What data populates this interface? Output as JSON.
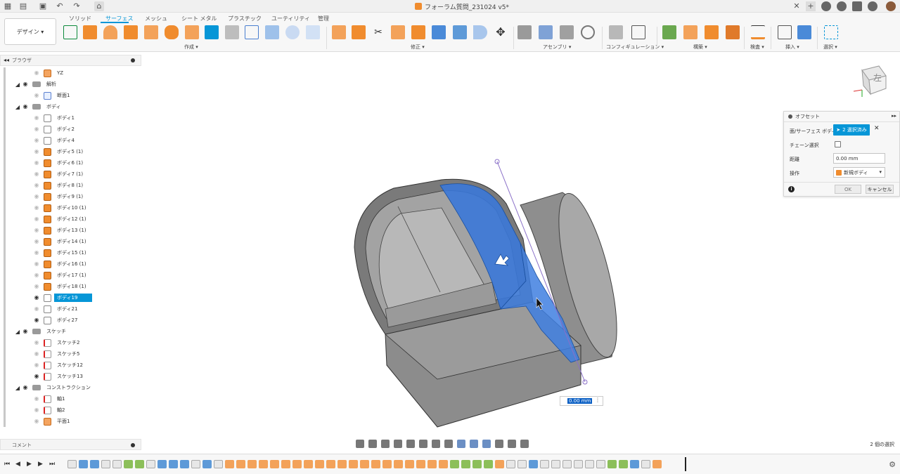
{
  "window": {
    "title": "フォーラム質問_231024 v5*"
  },
  "ribbon": {
    "workspace_label": "デザイン ▾",
    "tabs": [
      "ソリッド",
      "サーフェス",
      "メッシュ",
      "シート メタル",
      "プラスチック",
      "ユーティリティ",
      "管理"
    ],
    "active_tab": "サーフェス",
    "groups": [
      "作成 ▾",
      "修正 ▾",
      "アセンブリ ▾",
      "コンフィギュレーション ▾",
      "構築 ▾",
      "検査 ▾",
      "挿入 ▾",
      "選択 ▾"
    ]
  },
  "browser": {
    "title": "ブラウザ",
    "items": [
      {
        "label": "YZ",
        "icon": "plane-icon",
        "visible": false,
        "selected": false,
        "expand": false
      },
      {
        "label": "解析",
        "icon": "folder-icon",
        "visible": true,
        "selected": false,
        "expand": true
      },
      {
        "label": "断面1",
        "icon": "analysis-icon",
        "visible": false,
        "selected": false,
        "expand": false
      },
      {
        "label": "ボディ",
        "icon": "folder-icon",
        "visible": true,
        "selected": false,
        "expand": true
      },
      {
        "label": "ボディ1",
        "icon": "body-icon",
        "visible": false,
        "selected": false,
        "expand": false
      },
      {
        "label": "ボディ2",
        "icon": "body-icon",
        "visible": false,
        "selected": false,
        "expand": false
      },
      {
        "label": "ボディ4",
        "icon": "body-icon",
        "visible": false,
        "selected": false,
        "expand": false
      },
      {
        "label": "ボディ5 (1)",
        "icon": "component-icon",
        "visible": false,
        "selected": false,
        "expand": false
      },
      {
        "label": "ボディ6 (1)",
        "icon": "component-icon",
        "visible": false,
        "selected": false,
        "expand": false
      },
      {
        "label": "ボディ7 (1)",
        "icon": "component-icon",
        "visible": false,
        "selected": false,
        "expand": false
      },
      {
        "label": "ボディ8 (1)",
        "icon": "component-icon",
        "visible": false,
        "selected": false,
        "expand": false
      },
      {
        "label": "ボディ9 (1)",
        "icon": "component-icon",
        "visible": false,
        "selected": false,
        "expand": false
      },
      {
        "label": "ボディ10 (1)",
        "icon": "component-icon",
        "visible": false,
        "selected": false,
        "expand": false
      },
      {
        "label": "ボディ12 (1)",
        "icon": "component-icon",
        "visible": false,
        "selected": false,
        "expand": false
      },
      {
        "label": "ボディ13 (1)",
        "icon": "component-icon",
        "visible": false,
        "selected": false,
        "expand": false
      },
      {
        "label": "ボディ14 (1)",
        "icon": "component-icon",
        "visible": false,
        "selected": false,
        "expand": false
      },
      {
        "label": "ボディ15 (1)",
        "icon": "component-icon",
        "visible": false,
        "selected": false,
        "expand": false
      },
      {
        "label": "ボディ16 (1)",
        "icon": "component-icon",
        "visible": false,
        "selected": false,
        "expand": false
      },
      {
        "label": "ボディ17 (1)",
        "icon": "component-icon",
        "visible": false,
        "selected": false,
        "expand": false
      },
      {
        "label": "ボディ18 (1)",
        "icon": "component-icon",
        "visible": false,
        "selected": false,
        "expand": false
      },
      {
        "label": "ボディ19",
        "icon": "body-icon",
        "visible": true,
        "selected": true,
        "expand": false
      },
      {
        "label": "ボディ21",
        "icon": "body-icon",
        "visible": false,
        "selected": false,
        "expand": false
      },
      {
        "label": "ボディ27",
        "icon": "body-icon",
        "visible": true,
        "selected": false,
        "expand": false
      },
      {
        "label": "スケッチ",
        "icon": "folder-icon",
        "visible": true,
        "selected": false,
        "expand": true
      },
      {
        "label": "スケッチ2",
        "icon": "sketch-icon",
        "visible": false,
        "selected": false,
        "expand": false
      },
      {
        "label": "スケッチ5",
        "icon": "sketch-icon",
        "visible": false,
        "selected": false,
        "expand": false
      },
      {
        "label": "スケッチ12",
        "icon": "sketch-icon",
        "visible": false,
        "selected": false,
        "expand": false
      },
      {
        "label": "スケッチ13",
        "icon": "sketch-icon",
        "visible": true,
        "selected": false,
        "expand": false
      },
      {
        "label": "コンストラクション",
        "icon": "folder-icon",
        "visible": true,
        "selected": false,
        "expand": true
      },
      {
        "label": "軸1",
        "icon": "axis-icon",
        "visible": false,
        "selected": false,
        "expand": false
      },
      {
        "label": "軸2",
        "icon": "axis-icon",
        "visible": false,
        "selected": false,
        "expand": false
      },
      {
        "label": "平面1",
        "icon": "plane-icon",
        "visible": false,
        "selected": false,
        "expand": false
      }
    ]
  },
  "comments": {
    "title": "コメント"
  },
  "viewcube": {
    "face_label": "左"
  },
  "offset_panel": {
    "title": "オフセット",
    "surface_label": "面/サーフェス ボディ",
    "selection_button": "2 選択済み",
    "chain_label": "チェーン選択",
    "distance_label": "距離",
    "distance_value": "0.00 mm",
    "operation_label": "操作",
    "operation_value": "新規ボディ",
    "ok": "OK",
    "cancel": "キャンセル"
  },
  "manipulator": {
    "value": "0.00 mm"
  },
  "status": {
    "selection_count": "2 個の選択"
  },
  "colors": {
    "accent": "#0696d7",
    "orange": "#f08c2e",
    "selection_blue": "#2f6fd0",
    "body_grey": "#8a8a8a"
  }
}
